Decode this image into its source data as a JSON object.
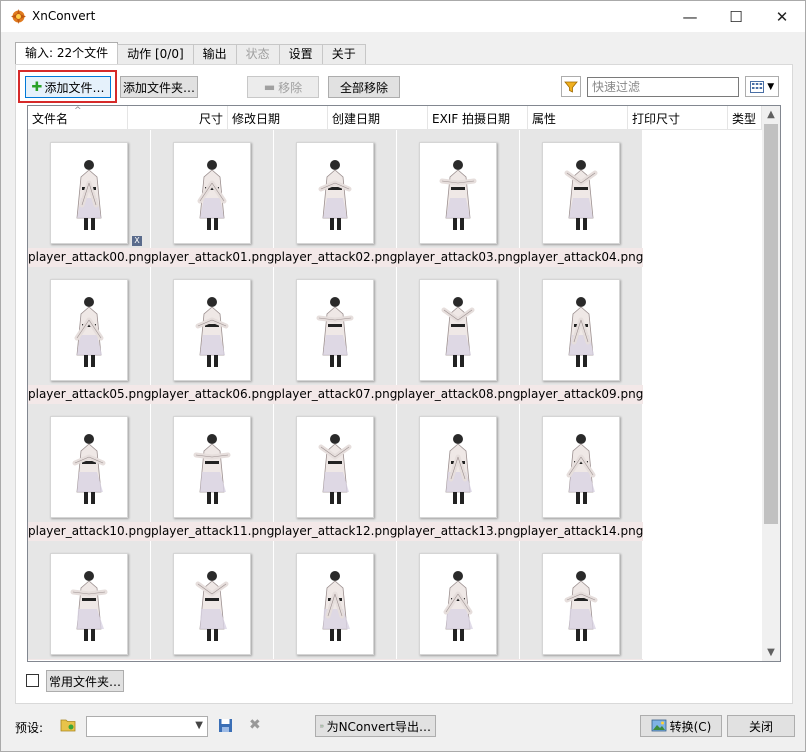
{
  "window": {
    "title": "XnConvert",
    "min": "—",
    "max": "☐",
    "close": "✕"
  },
  "tabs": [
    {
      "label": "输入:  22个文件",
      "active": true,
      "disabled": false
    },
    {
      "label": "动作 [0/0]",
      "active": false,
      "disabled": false
    },
    {
      "label": "输出",
      "active": false,
      "disabled": false
    },
    {
      "label": "状态",
      "active": false,
      "disabled": true
    },
    {
      "label": "设置",
      "active": false,
      "disabled": false
    },
    {
      "label": "关于",
      "active": false,
      "disabled": false
    }
  ],
  "toolbar": {
    "add_files": "添加文件…",
    "add_folder": "添加文件夹…",
    "remove": "移除",
    "remove_all": "全部移除",
    "filter_placeholder": "快速过滤"
  },
  "columns": [
    "文件名",
    "尺寸",
    "修改日期",
    "创建日期",
    "EXIF 拍摄日期",
    "属性",
    "打印尺寸",
    "类型"
  ],
  "files": [
    "player_attack00.png",
    "player_attack01.png",
    "player_attack02.png",
    "player_attack03.png",
    "player_attack04.png",
    "player_attack05.png",
    "player_attack06.png",
    "player_attack07.png",
    "player_attack08.png",
    "player_attack09.png",
    "player_attack10.png",
    "player_attack11.png",
    "player_attack12.png",
    "player_attack13.png",
    "player_attack14.png",
    "",
    "",
    "",
    "",
    ""
  ],
  "badge": "X",
  "favorites": {
    "label": "常用文件夹…"
  },
  "bottom": {
    "preset_label": "预设:",
    "export_label": "为NConvert导出…",
    "convert_label": "转换(C)",
    "close_label": "关闭"
  },
  "colors": {
    "accent": "#0078d7",
    "highlight": "#d62a2a",
    "tile_bg": "#e6e6e6"
  },
  "icons": [
    "app-icon",
    "plus-icon",
    "minus-icon",
    "filter-icon",
    "view-grid-icon",
    "folder-icon",
    "save-icon",
    "delete-icon",
    "export-icon",
    "convert-icon"
  ]
}
